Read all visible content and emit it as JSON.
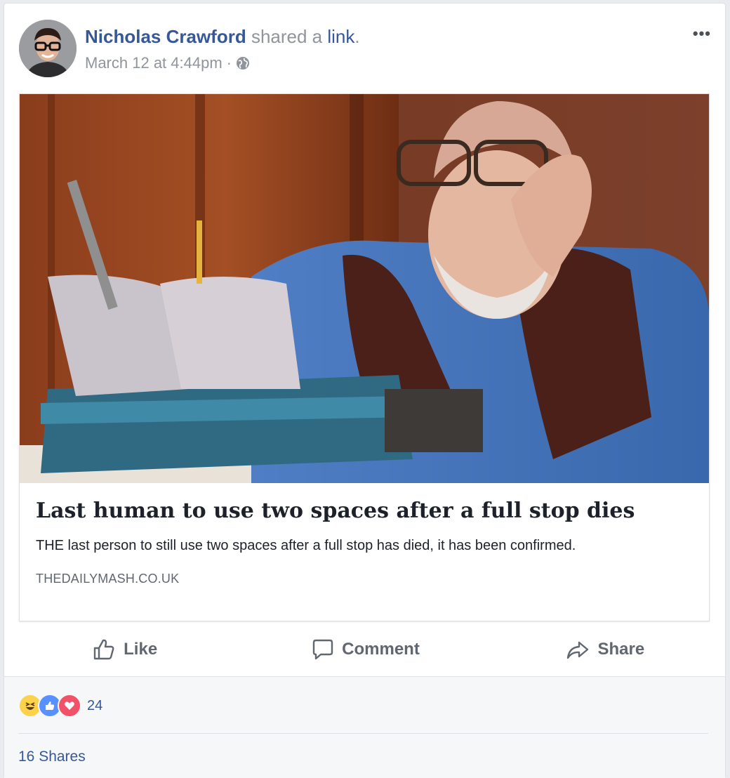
{
  "post": {
    "author": "Nicholas Crawford",
    "action_text": "shared a",
    "action_link": "link",
    "action_end": ".",
    "timestamp": "March 12 at 4:44pm",
    "separator": "·",
    "privacy_icon": "globe-icon",
    "more_label": "•••"
  },
  "link_card": {
    "title": "Last human to use two spaces after a full stop dies",
    "description": "THE last person to still use two spaces after a full stop has died, it has been confirmed.",
    "domain": "THEDAILYMASH.CO.UK"
  },
  "actions": {
    "like": "Like",
    "comment": "Comment",
    "share": "Share"
  },
  "reactions": {
    "types": [
      "haha",
      "like",
      "love"
    ],
    "count": "24"
  },
  "shares_label": "16 Shares",
  "colors": {
    "link_blue": "#365899",
    "gray_text": "#90949c",
    "like_blue": "#5890ff",
    "love_red": "#f25268",
    "haha_yellow": "#fcd24a"
  }
}
